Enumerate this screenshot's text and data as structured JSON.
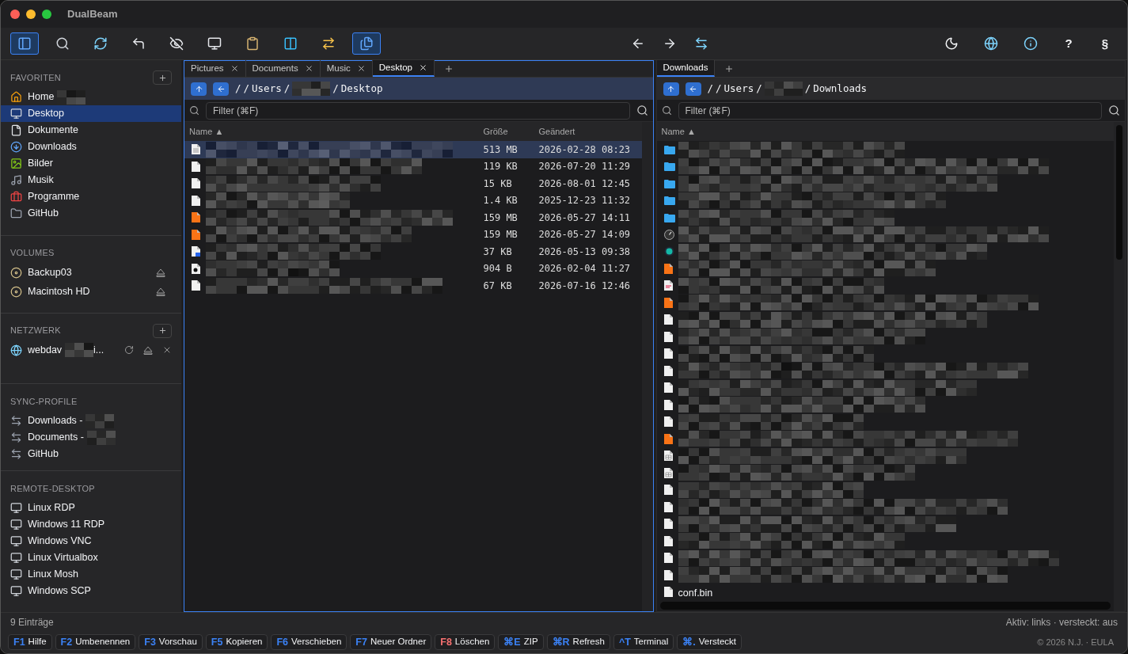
{
  "window": {
    "title": "DualBeam"
  },
  "toolbar": {
    "left": [
      {
        "kind": "sidebar",
        "selected": true
      },
      {
        "kind": "search",
        "selected": false
      },
      {
        "kind": "sync",
        "selected": false
      },
      {
        "kind": "up",
        "selected": false
      },
      {
        "kind": "hidden",
        "selected": false
      },
      {
        "kind": "monitor",
        "selected": false
      },
      {
        "kind": "clipboard",
        "selected": false
      },
      {
        "kind": "columns",
        "selected": false
      },
      {
        "kind": "compare",
        "selected": false
      },
      {
        "kind": "copy",
        "selected": true
      }
    ],
    "center": [
      {
        "kind": "back"
      },
      {
        "kind": "forward"
      },
      {
        "kind": "swap"
      }
    ],
    "right": [
      {
        "kind": "moon"
      },
      {
        "kind": "globe"
      },
      {
        "kind": "info"
      },
      {
        "kind": "text",
        "label": "?"
      },
      {
        "kind": "text",
        "label": "§"
      }
    ]
  },
  "sidebar": {
    "sections": [
      {
        "title": "FAVORITEN",
        "add": true,
        "items": [
          {
            "kind": "home",
            "label": "Home",
            "redacted": true,
            "selected": false
          },
          {
            "kind": "monitor",
            "label": "Desktop",
            "selected": true
          },
          {
            "kind": "doc",
            "label": "Dokumente",
            "selected": false
          },
          {
            "kind": "download",
            "label": "Downloads",
            "selected": false
          },
          {
            "kind": "image",
            "label": "Bilder",
            "selected": false
          },
          {
            "kind": "music",
            "label": "Musik",
            "selected": false
          },
          {
            "kind": "toolbox",
            "label": "Programme",
            "selected": false
          },
          {
            "kind": "folder",
            "label": "GitHub",
            "selected": false
          }
        ]
      },
      {
        "title": "VOLUMES",
        "add": false,
        "items": [
          {
            "kind": "disk",
            "label": "Backup03",
            "eject": true,
            "selected": false
          },
          {
            "kind": "disk",
            "label": "Macintosh HD",
            "eject": true,
            "selected": false
          }
        ]
      },
      {
        "title": "NETZWERK",
        "add": true,
        "items": [
          {
            "kind": "globe",
            "label": "webdav",
            "suffix": "i...",
            "redacted": true,
            "refresh": true,
            "eject": true,
            "close": true,
            "selected": false
          }
        ]
      },
      {
        "title": "SYNC-PROFILE",
        "add": false,
        "items": [
          {
            "kind": "sync",
            "label": "Downloads -",
            "redacted": true,
            "selected": false
          },
          {
            "kind": "sync",
            "label": "Documents -",
            "redacted": true,
            "selected": false
          },
          {
            "kind": "sync",
            "label": "GitHub",
            "selected": false
          }
        ]
      },
      {
        "title": "REMOTE-DESKTOP",
        "add": false,
        "items": [
          {
            "kind": "monitor",
            "label": "Linux RDP",
            "selected": false
          },
          {
            "kind": "monitor",
            "label": "Windows 11 RDP",
            "selected": false
          },
          {
            "kind": "monitor",
            "label": "Windows VNC",
            "selected": false
          },
          {
            "kind": "monitor",
            "label": "Linux Virtualbox",
            "selected": false
          },
          {
            "kind": "monitor",
            "label": "Linux Mosh",
            "selected": false
          },
          {
            "kind": "monitor",
            "label": "Windows SCP",
            "selected": false
          }
        ]
      }
    ]
  },
  "left_pane": {
    "active": true,
    "tabs": [
      {
        "label": "Pictures",
        "selected": false
      },
      {
        "label": "Documents",
        "selected": false
      },
      {
        "label": "Music",
        "selected": false
      },
      {
        "label": "Desktop",
        "selected": true
      }
    ],
    "path": [
      "/",
      "/",
      "Users",
      "/",
      "/",
      "Desktop"
    ],
    "filter": {
      "placeholder": "Filter (⌘F)"
    },
    "columns": [
      "Name ▲",
      "Größe",
      "Geändert"
    ],
    "rows": [
      {
        "kind": "text",
        "size": "513 MB",
        "modified": "2026-02-28 08:23",
        "selected": true
      },
      {
        "kind": "doc",
        "size": "119 KB",
        "modified": "2026-07-20 11:29",
        "selected": false
      },
      {
        "kind": "doc",
        "size": "15 KB",
        "modified": "2026-08-01 12:45",
        "selected": false
      },
      {
        "kind": "doc",
        "size": "1.4 KB",
        "modified": "2025-12-23 11:32",
        "selected": false
      },
      {
        "kind": "media",
        "size": "159 MB",
        "modified": "2026-05-27 14:11",
        "selected": false
      },
      {
        "kind": "media",
        "size": "159 MB",
        "modified": "2026-05-27 14:09",
        "selected": false
      },
      {
        "kind": "word",
        "size": "37 KB",
        "modified": "2026-05-13 09:38",
        "selected": false
      },
      {
        "kind": "script",
        "size": "904 B",
        "modified": "2026-02-04 11:27",
        "selected": false
      },
      {
        "kind": "doc",
        "size": "67 KB",
        "modified": "2026-07-16 12:46",
        "selected": false
      }
    ]
  },
  "right_pane": {
    "active": false,
    "tabs": [
      {
        "label": "Downloads",
        "selected": true
      }
    ],
    "path": [
      "/",
      "/",
      "Users",
      "/",
      "/",
      "Downloads"
    ],
    "filter": {
      "placeholder": "Filter (⌘F)"
    },
    "columns": [
      "Name ▲"
    ],
    "rows": [
      {
        "kind": "folder"
      },
      {
        "kind": "folder"
      },
      {
        "kind": "folder"
      },
      {
        "kind": "folder"
      },
      {
        "kind": "folder"
      },
      {
        "kind": "app"
      },
      {
        "kind": "teal"
      },
      {
        "kind": "media"
      },
      {
        "kind": "pdf"
      },
      {
        "kind": "media"
      },
      {
        "kind": "doc"
      },
      {
        "kind": "doc"
      },
      {
        "kind": "doc"
      },
      {
        "kind": "doc"
      },
      {
        "kind": "doc"
      },
      {
        "kind": "doc"
      },
      {
        "kind": "doc"
      },
      {
        "kind": "media"
      },
      {
        "kind": "sheet"
      },
      {
        "kind": "sheet"
      },
      {
        "kind": "doc"
      },
      {
        "kind": "doc"
      },
      {
        "kind": "doc"
      },
      {
        "kind": "doc"
      },
      {
        "kind": "doc"
      },
      {
        "kind": "doc"
      },
      {
        "kind": "doc",
        "name": "conf.bin"
      }
    ]
  },
  "status_bar": {
    "left": "9 Einträge",
    "right": "Aktiv: links · versteckt: aus",
    "footer": "© 2026 N.J. · EULA"
  },
  "function_keys": [
    {
      "key": "F1",
      "label": "Hilfe",
      "color": "#3b82f6"
    },
    {
      "key": "F2",
      "label": "Umbenennen",
      "color": "#3b82f6"
    },
    {
      "key": "F3",
      "label": "Vorschau",
      "color": "#3b82f6"
    },
    {
      "key": "F5",
      "label": "Kopieren",
      "color": "#3b82f6"
    },
    {
      "key": "F6",
      "label": "Verschieben",
      "color": "#3b82f6"
    },
    {
      "key": "F7",
      "label": "Neuer Ordner",
      "color": "#3b82f6"
    },
    {
      "key": "F8",
      "label": "Löschen",
      "color": "#f87171"
    },
    {
      "key": "⌘E",
      "label": "ZIP",
      "color": "#3b82f6"
    },
    {
      "key": "⌘R",
      "label": "Refresh",
      "color": "#3b82f6"
    },
    {
      "key": "^T",
      "label": "Terminal",
      "color": "#3b82f6"
    },
    {
      "key": "⌘.",
      "label": "Versteckt",
      "color": "#3b82f6"
    }
  ]
}
